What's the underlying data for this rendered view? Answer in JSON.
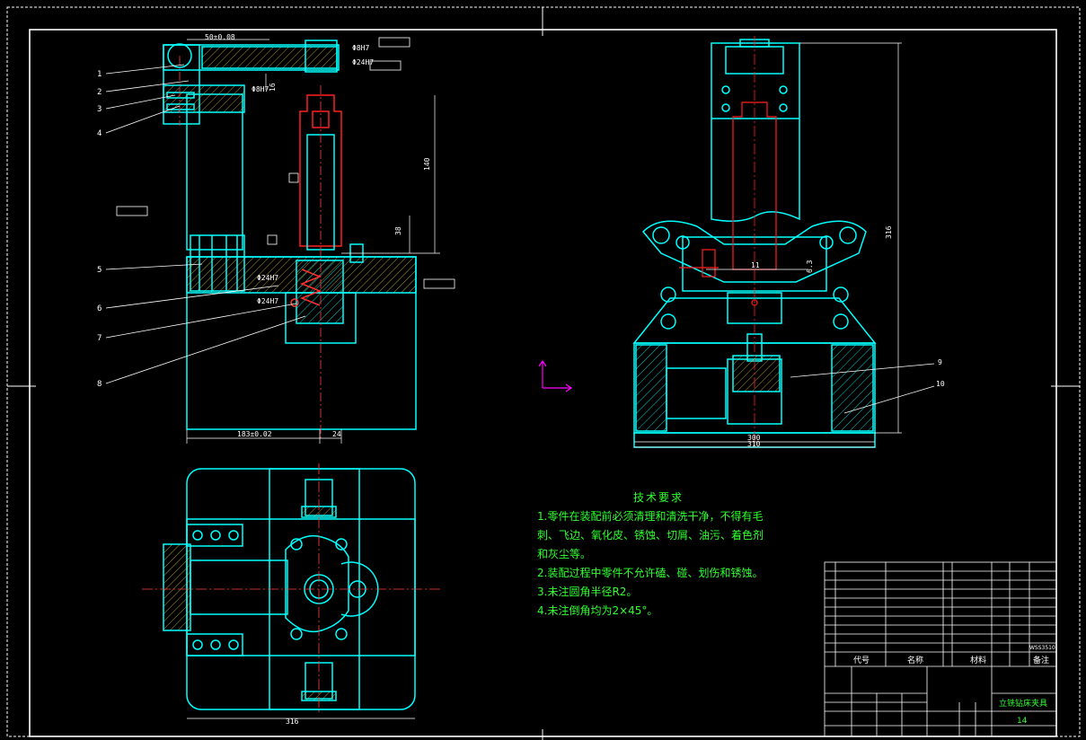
{
  "drawing": {
    "border_color": "#ffffff",
    "geometry_color": "#00ffff",
    "section_color": "#ff2020",
    "text_color": "#30ff30",
    "axis_color": "#ff00ff"
  },
  "dimensions": {
    "top_tol": "50±0.08",
    "bottom_tol": "183±0.02",
    "bottom_24": "24",
    "height_140": "140",
    "height_38": "38",
    "height_16": "16",
    "right_height": "316",
    "right_width": "300",
    "right_inner": "310",
    "right_11": "11",
    "right_6": "6.3",
    "plan_width": "316",
    "fit_1": "Φ8H7",
    "fit_2": "Φ24H7",
    "fit_3": "Φ8H7",
    "fit_4": "Φ24H7",
    "fit_5": "Φ24H7"
  },
  "balloons": {
    "left": [
      "1",
      "2",
      "3",
      "4",
      "5",
      "6",
      "7",
      "8"
    ],
    "right": [
      "9",
      "10"
    ]
  },
  "tech_requirements": {
    "title": "技术要求",
    "lines": [
      "1.零件在装配前必须清理和清洗干净，不得有毛",
      "刺、飞边、氧化皮、锈蚀、切屑、油污、着色剂",
      "和灰尘等。",
      "2.装配过程中零件不允许磕、碰、划伤和锈蚀。",
      "3.未注圆角半径R2。",
      "4.未注倒角均为2×45°。"
    ]
  },
  "title_block": {
    "col_code": "代号",
    "col_name": "名称",
    "col_material": "材料",
    "col_notes": "备注",
    "drawing_name": "立铣钻床夹具",
    "sheet_no": "14",
    "part_no": "WSS3510"
  }
}
